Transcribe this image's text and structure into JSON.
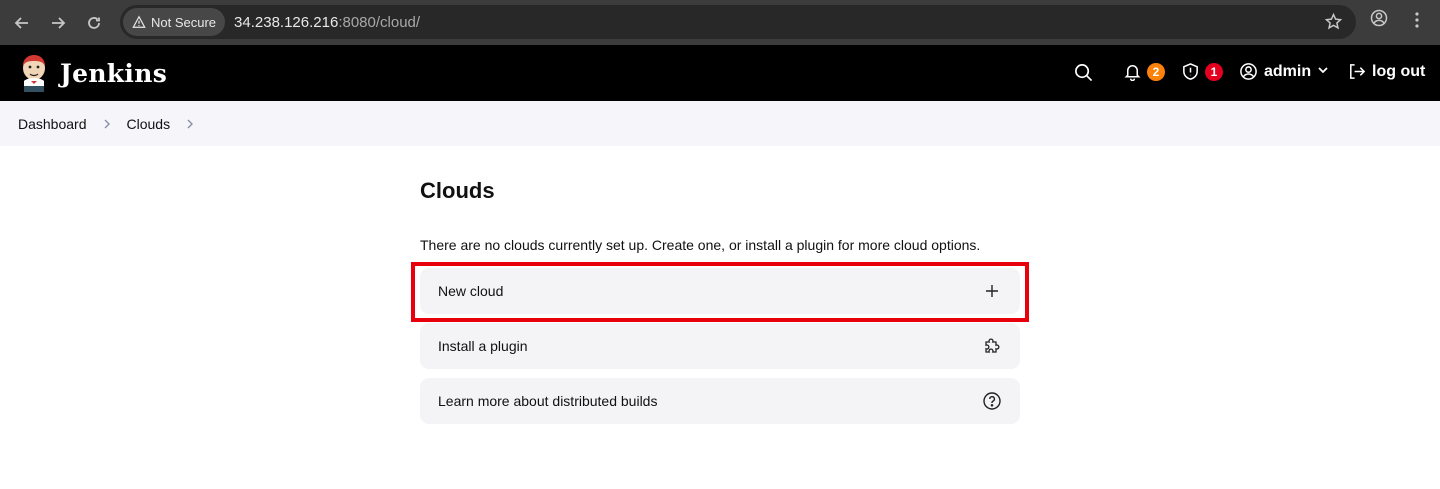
{
  "browser": {
    "security_label": "Not Secure",
    "url_host": "34.238.126.216",
    "url_rest": ":8080/cloud/"
  },
  "header": {
    "brand": "Jenkins",
    "notifications_count": "2",
    "security_count": "1",
    "user": "admin",
    "logout": "log out"
  },
  "breadcrumb": {
    "items": [
      "Dashboard",
      "Clouds"
    ]
  },
  "main": {
    "title": "Clouds",
    "description": "There are no clouds currently set up. Create one, or install a plugin for more cloud options.",
    "actions": [
      {
        "label": "New cloud",
        "icon": "plus-icon"
      },
      {
        "label": "Install a plugin",
        "icon": "puzzle-icon"
      },
      {
        "label": "Learn more about distributed builds",
        "icon": "help-circle-icon"
      }
    ]
  },
  "colors": {
    "header_bg": "#000000",
    "breadcrumb_bg": "#f5f5fa",
    "highlight": "#e8000c",
    "badge_orange": "#fe820a",
    "badge_red": "#e6001f"
  }
}
